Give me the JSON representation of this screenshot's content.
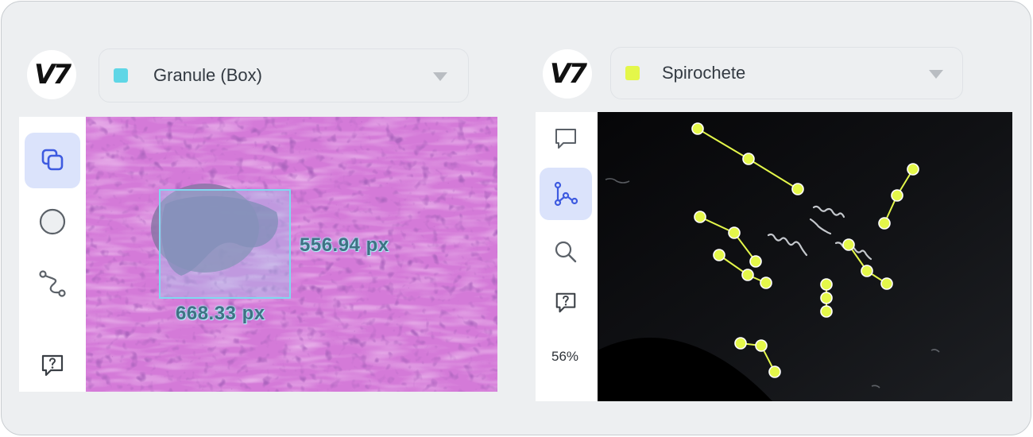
{
  "left_panel": {
    "logo": "V7",
    "class_selector": {
      "label": "Granule (Box)",
      "color": "#5fd6e6"
    },
    "tools": [
      {
        "icon": "copy-layers-icon",
        "active": true
      },
      {
        "icon": "ellipse-icon",
        "active": false
      },
      {
        "icon": "path-icon",
        "active": false
      },
      {
        "icon": "help-comment-icon",
        "active": false
      }
    ],
    "annotation": {
      "width_label": "668.33 px",
      "height_label": "556.94 px",
      "color": "#7fd9f0"
    }
  },
  "right_panel": {
    "logo": "V7",
    "class_selector": {
      "label": "Spirochete",
      "color": "#e4f74a"
    },
    "tools": [
      {
        "icon": "comment-icon",
        "active": false
      },
      {
        "icon": "skeleton-icon",
        "active": true
      },
      {
        "icon": "zoom-icon",
        "active": false
      },
      {
        "icon": "help-comment-icon",
        "active": false
      }
    ],
    "zoom_label": "56%",
    "annotation_color": "#e4f74a"
  }
}
